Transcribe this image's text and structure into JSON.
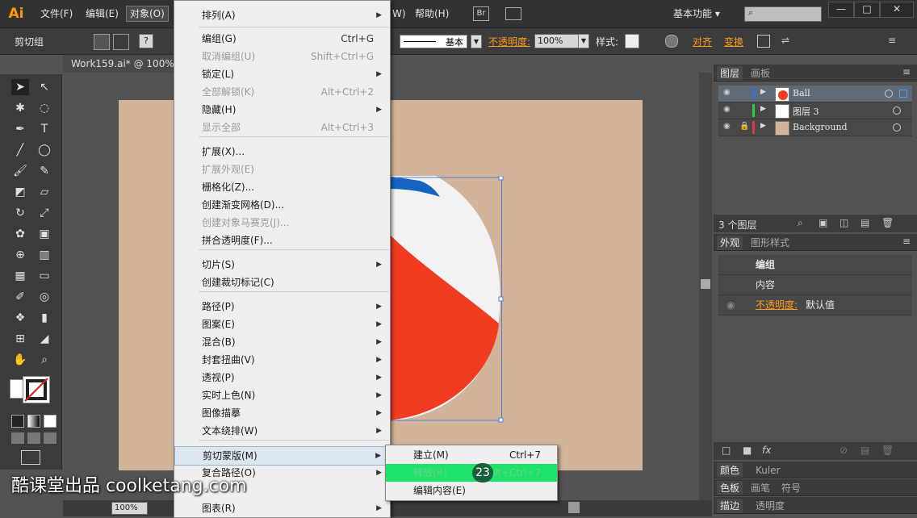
{
  "app": {
    "logo": "Ai",
    "workspace": "基本功能",
    "win_min": "—",
    "win_max": "□",
    "win_close": "✕"
  },
  "menubar": {
    "items": [
      "文件(F)",
      "编辑(E)",
      "对象(O)",
      "W)",
      "帮助(H)"
    ],
    "br": "Br"
  },
  "controlbar": {
    "selection_type": "剪切组",
    "stroke_label": "基本",
    "opacity_label": "不透明度:",
    "opacity_value": "100%",
    "style_label": "样式:",
    "align_label": "对齐",
    "transform_label": "变换",
    "q_mark": "?"
  },
  "document": {
    "tab_title": "Work159.ai* @ 100%",
    "zoom": "100%"
  },
  "object_menu": {
    "top_partial": "排列(A)",
    "items": [
      {
        "label": "编组(G)",
        "shortcut": "Ctrl+G",
        "enabled": true
      },
      {
        "label": "取消编组(U)",
        "shortcut": "Shift+Ctrl+G",
        "enabled": false
      },
      {
        "label": "锁定(L)",
        "shortcut": "",
        "enabled": true,
        "submenu": true
      },
      {
        "label": "全部解锁(K)",
        "shortcut": "Alt+Ctrl+2",
        "enabled": false
      },
      {
        "label": "隐藏(H)",
        "shortcut": "",
        "enabled": true,
        "submenu": true
      },
      {
        "label": "显示全部",
        "shortcut": "Alt+Ctrl+3",
        "enabled": false
      },
      {
        "label": "扩展(X)...",
        "shortcut": "",
        "enabled": true
      },
      {
        "label": "扩展外观(E)",
        "shortcut": "",
        "enabled": false
      },
      {
        "label": "栅格化(Z)...",
        "shortcut": "",
        "enabled": true
      },
      {
        "label": "创建渐变网格(D)...",
        "shortcut": "",
        "enabled": true
      },
      {
        "label": "创建对象马赛克(J)...",
        "shortcut": "",
        "enabled": false
      },
      {
        "label": "拼合透明度(F)...",
        "shortcut": "",
        "enabled": true
      },
      {
        "label": "切片(S)",
        "shortcut": "",
        "enabled": true,
        "submenu": true
      },
      {
        "label": "创建裁切标记(C)",
        "shortcut": "",
        "enabled": true
      },
      {
        "label": "路径(P)",
        "shortcut": "",
        "enabled": true,
        "submenu": true
      },
      {
        "label": "图案(E)",
        "shortcut": "",
        "enabled": true,
        "submenu": true
      },
      {
        "label": "混合(B)",
        "shortcut": "",
        "enabled": true,
        "submenu": true
      },
      {
        "label": "封套扭曲(V)",
        "shortcut": "",
        "enabled": true,
        "submenu": true
      },
      {
        "label": "透视(P)",
        "shortcut": "",
        "enabled": true,
        "submenu": true
      },
      {
        "label": "实时上色(N)",
        "shortcut": "",
        "enabled": true,
        "submenu": true
      },
      {
        "label": "图像描摹",
        "shortcut": "",
        "enabled": true,
        "submenu": true
      },
      {
        "label": "文本绕排(W)",
        "shortcut": "",
        "enabled": true,
        "submenu": true
      },
      {
        "label": "剪切蒙版(M)",
        "shortcut": "",
        "enabled": true,
        "submenu": true,
        "highlighted": true
      },
      {
        "label": "复合路径(O)",
        "shortcut": "",
        "enabled": true,
        "submenu": true
      },
      {
        "label": "图表(R)",
        "shortcut": "",
        "enabled": true,
        "submenu": true
      }
    ]
  },
  "clip_submenu": {
    "items": [
      {
        "label": "建立(M)",
        "shortcut": "Ctrl+7"
      },
      {
        "label": "释放(R)",
        "shortcut": "Alt+Ctrl+7"
      },
      {
        "label": "编辑内容(E)",
        "shortcut": ""
      }
    ],
    "step_badge": "23"
  },
  "layers_panel": {
    "tabs": [
      "图层",
      "画板"
    ],
    "layers": [
      {
        "name": "Ball",
        "color": "#3b6fd8"
      },
      {
        "name": "图层 3",
        "color": "#2ecc40"
      },
      {
        "name": "Background",
        "color": "#e03b3b"
      }
    ],
    "count": "3 个图层"
  },
  "appearance_panel": {
    "tabs": [
      "外观",
      "图形样式"
    ],
    "title": "编组",
    "content": "内容",
    "opacity_label": "不透明度:",
    "opacity_value": "默认值"
  },
  "bottom_panels": {
    "row1": [
      "颜色",
      "Kuler"
    ],
    "row2": [
      "色板",
      "画笔",
      "符号"
    ],
    "row3": [
      "描边",
      "透明度"
    ]
  },
  "watermark": "酷课堂出品 coolketang.com"
}
